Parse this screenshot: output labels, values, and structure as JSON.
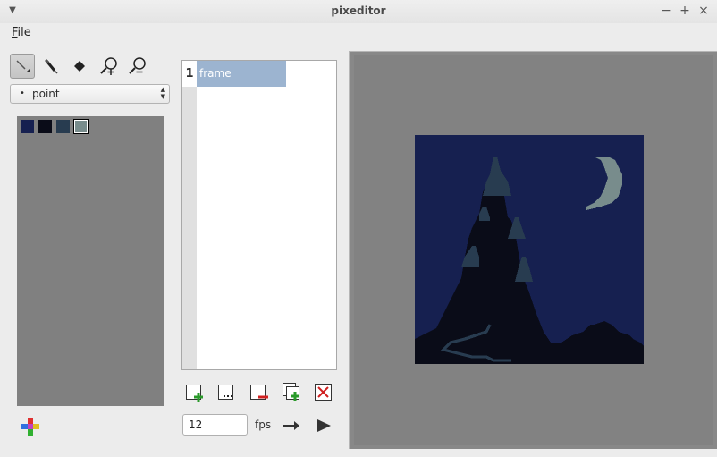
{
  "window": {
    "title": "pixeditor"
  },
  "menu": {
    "file_underlined": "F",
    "file_rest": "ile"
  },
  "tools": {
    "items": [
      {
        "name": "pen-tool",
        "icon": "pencil-icon"
      },
      {
        "name": "pipette-tool",
        "icon": "pipette-icon"
      },
      {
        "name": "fill-tool",
        "icon": "fill-icon"
      },
      {
        "name": "zoom-in-tool",
        "icon": "zoom-in-icon"
      },
      {
        "name": "zoom-out-tool",
        "icon": "zoom-out-icon"
      }
    ],
    "active": "pen-tool"
  },
  "brush": {
    "shape_value": "point"
  },
  "palette": {
    "colors": [
      "#162050",
      "#0a0c18",
      "#283c50",
      "#788c8c"
    ],
    "selected_index": 3
  },
  "frames": {
    "items": [
      {
        "number": "1",
        "name": "frame"
      }
    ]
  },
  "animation": {
    "fps_value": "12",
    "fps_label": "fps"
  },
  "artwork": {
    "colors": {
      "sky": "#162050",
      "castle": "#0a0c18",
      "roof": "#283c50",
      "moon": "#788c8c"
    }
  }
}
